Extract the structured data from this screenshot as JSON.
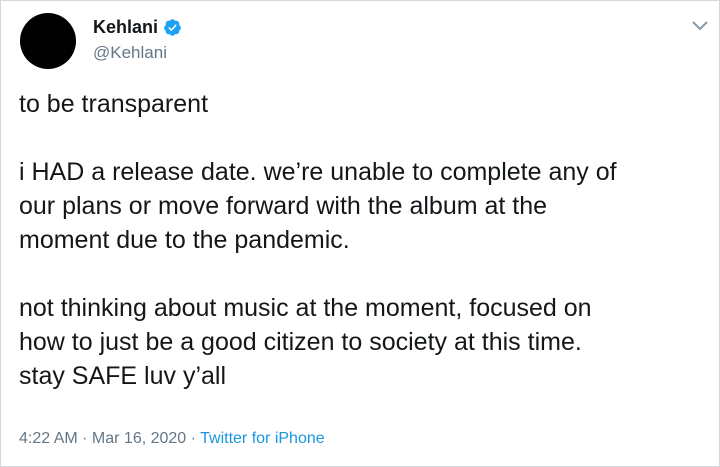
{
  "author": {
    "display_name": "Kehlani",
    "handle": "@Kehlani",
    "verified_icon": "verified-badge-icon",
    "verified_color": "#1da1f2"
  },
  "tweet": {
    "paragraphs": [
      "to be transparent",
      "i HAD a release date. we’re unable to complete any of\nour plans or move forward with the album at the\nmoment due to the pandemic.",
      "not thinking about music at the moment, focused on\nhow to just be a good citizen to society at this time.\nstay SAFE luv y’all"
    ]
  },
  "meta": {
    "time": "4:22 AM",
    "separator": " · ",
    "date": "Mar 16, 2020",
    "source": "Twitter for iPhone"
  },
  "colors": {
    "text": "#14171a",
    "muted": "#657786",
    "link": "#1b95e0",
    "border": "#cfd9de"
  },
  "icons": {
    "menu": "chevron-down-icon"
  }
}
